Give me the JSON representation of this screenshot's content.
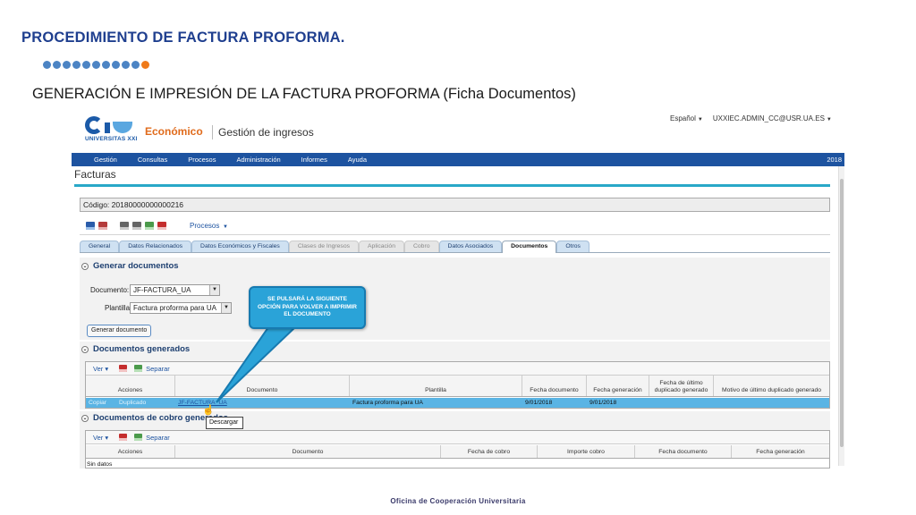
{
  "slide": {
    "title": "PROCEDIMIENTO DE FACTURA PROFORMA.",
    "subtitle": "GENERACIÓN E IMPRESIÓN DE LA FACTURA PROFORMA (Ficha Documentos)",
    "footer": "Oficina de Cooperación Universitaria",
    "colors": {
      "title": "#1f3f8f",
      "dots_blue": "#4c84c4",
      "dots_orange": "#ef7a1a"
    }
  },
  "app": {
    "brand_text": "UNIVERSITAS XXI",
    "app_name": "Económico",
    "module": "Gestión de ingresos",
    "language": "Español",
    "user": "UXXIEC.ADMIN_CC@USR.UA.ES",
    "menu": [
      "Gestión",
      "Consultas",
      "Procesos",
      "Administración",
      "Informes",
      "Ayuda"
    ],
    "year": "2018",
    "page_title": "Facturas",
    "codigo": "Código: 20180000000000216",
    "toolbar": {
      "procesos_label": "Procesos"
    },
    "tabs": [
      {
        "label": "General",
        "state": "normal"
      },
      {
        "label": "Datos Relacionados",
        "state": "normal"
      },
      {
        "label": "Datos Económicos y Fiscales",
        "state": "normal"
      },
      {
        "label": "Clases de Ingresos",
        "state": "dim"
      },
      {
        "label": "Aplicación",
        "state": "dim"
      },
      {
        "label": "Cobro",
        "state": "dim"
      },
      {
        "label": "Datos Asociados",
        "state": "normal"
      },
      {
        "label": "Documentos",
        "state": "active"
      },
      {
        "label": "Otros",
        "state": "normal"
      }
    ],
    "generar": {
      "header": "Generar documentos",
      "documento_label": "Documento:",
      "documento_value": "JF-FACTURA_UA",
      "plantilla_label": "Plantilla",
      "plantilla_value": "Factura proforma para UA",
      "button": "Generar documento"
    },
    "generados": {
      "header": "Documentos generados",
      "toolbar_ver": "Ver",
      "toolbar_separar": "Separar",
      "columns": [
        "Acciones",
        "Documento",
        "Plantilla",
        "Fecha documento",
        "Fecha generación",
        "Fecha de último duplicado generado",
        "Motivo de último duplicado generado"
      ],
      "rows": [
        {
          "acciones": [
            "Copiar",
            "Duplicado"
          ],
          "documento": "JF-FACTURA_UA",
          "plantilla": "Factura proforma para UA",
          "fecha_doc": "9/01/2018",
          "fecha_gen": "9/01/2018",
          "fecha_dup": "",
          "motivo": ""
        }
      ]
    },
    "cobro": {
      "header": "Documentos de cobro generados",
      "toolbar_ver": "Ver",
      "toolbar_separar": "Separar",
      "columns": [
        "Acciones",
        "Documento",
        "Fecha de cobro",
        "Importe cobro",
        "Fecha documento",
        "Fecha generación"
      ],
      "empty": "Sin datos"
    },
    "callout": "SE PULSARÁ LA SIGUIENTE OPCIÓN PARA VOLVER A IMPRIMIR EL DOCUMENTO",
    "tooltip": "Descargar",
    "colors": {
      "menubar": "#1d53a0",
      "accent": "#29a8c8",
      "selected_row": "#5ab4e4",
      "callout": "#2aa3d8"
    }
  }
}
